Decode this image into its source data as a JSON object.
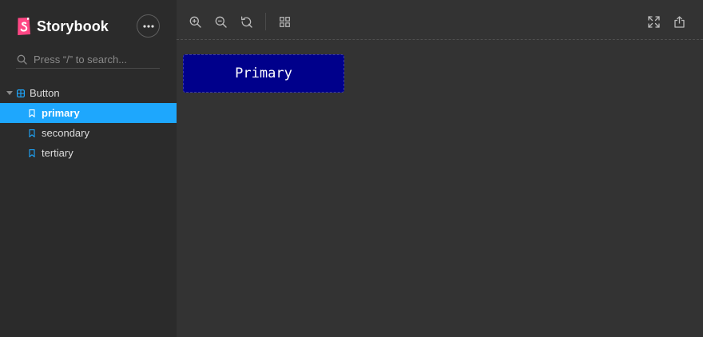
{
  "app": {
    "brand": "Storybook"
  },
  "search": {
    "placeholder": "Press “/” to search..."
  },
  "tree": {
    "component": "Button",
    "stories": [
      {
        "label": "primary",
        "active": true
      },
      {
        "label": "secondary",
        "active": false
      },
      {
        "label": "tertiary",
        "active": false
      }
    ]
  },
  "preview": {
    "button_label": "Primary",
    "button_color": "#00008b"
  },
  "colors": {
    "accent": "#1ea7fd",
    "brand": "#ff4785",
    "sidebar_bg": "#2b2b2b",
    "canvas_bg": "#333333"
  },
  "icons": {
    "toolbar_left": [
      "zoom-in-icon",
      "zoom-out-icon",
      "reset-zoom-icon",
      "grid-icon"
    ],
    "toolbar_right": [
      "fullscreen-icon",
      "share-icon"
    ]
  }
}
